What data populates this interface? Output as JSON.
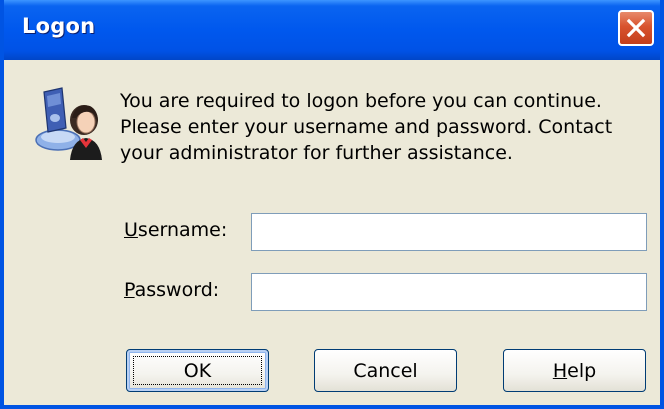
{
  "window": {
    "title": "Logon"
  },
  "icons": {
    "close": "close-icon",
    "logon": "logon-user-icon"
  },
  "message": {
    "lines": [
      "You are required to logon before you can continue.",
      "Please enter your username and password. Contact",
      "your administrator for further assistance."
    ]
  },
  "form": {
    "username": {
      "label_mnemonic": "U",
      "label_rest": "sername:",
      "value": ""
    },
    "password": {
      "label_mnemonic": "P",
      "label_rest": "assword:",
      "value": ""
    }
  },
  "buttons": {
    "ok": {
      "label": "OK"
    },
    "cancel": {
      "label": "Cancel"
    },
    "help": {
      "mnemonic": "H",
      "rest": "elp"
    }
  },
  "colors": {
    "titlebar": "#0058ee",
    "frame": "#0054e3",
    "dialog_bg": "#ece9d8",
    "close_button": "#d8532e",
    "field_border": "#7f9db9",
    "button_border": "#003c74"
  }
}
